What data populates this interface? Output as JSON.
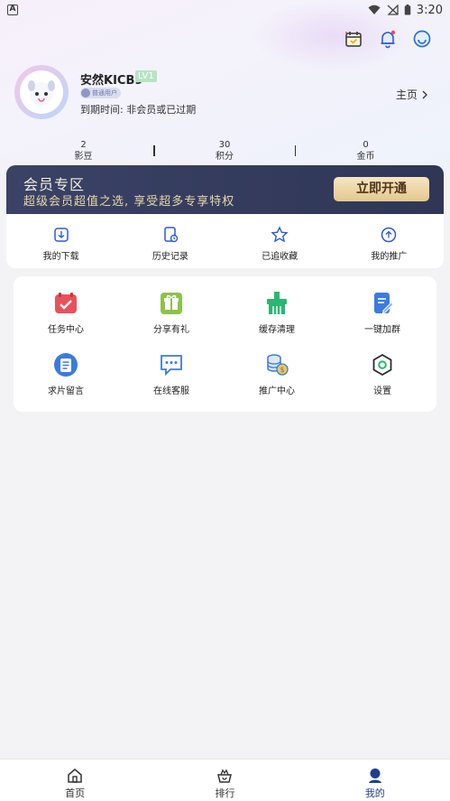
{
  "status_bar": {
    "left_indicator": "A",
    "time": "3:20"
  },
  "profile": {
    "username": "安然KICB9",
    "level": "LV1",
    "user_type": "普通用户",
    "expire_text": "到期时间: 非会员或已过期",
    "home_link": "主页"
  },
  "stats": [
    {
      "value": "2",
      "label": "影豆"
    },
    {
      "value": "30",
      "label": "积分"
    },
    {
      "value": "0",
      "label": "金币"
    }
  ],
  "vip": {
    "title": "会员专区",
    "description": "超级会员超值之选, 享受超多专享特权",
    "button": "立即开通"
  },
  "quick_actions": [
    {
      "label": "我的下载",
      "icon": "download-icon"
    },
    {
      "label": "历史记录",
      "icon": "history-icon"
    },
    {
      "label": "已追收藏",
      "icon": "star-icon"
    },
    {
      "label": "我的推广",
      "icon": "promote-icon"
    }
  ],
  "grid": [
    {
      "label": "任务中心",
      "icon": "task-center-icon",
      "color": "#e8515a"
    },
    {
      "label": "分享有礼",
      "icon": "gift-icon",
      "color": "#8bc34a"
    },
    {
      "label": "缓存清理",
      "icon": "cache-clean-icon",
      "color": "#2bb673"
    },
    {
      "label": "一键加群",
      "icon": "join-group-icon",
      "color": "#3b7be0"
    },
    {
      "label": "求片留言",
      "icon": "request-icon",
      "color": "#3b7be0"
    },
    {
      "label": "在线客服",
      "icon": "customer-service-icon",
      "color": "#3b7be0"
    },
    {
      "label": "推广中心",
      "icon": "promotion-center-icon",
      "color": "#3b7be0"
    },
    {
      "label": "设置",
      "icon": "settings-icon",
      "color": "#2a2a2a"
    }
  ],
  "bottom_nav": [
    {
      "label": "首页",
      "icon": "home-icon"
    },
    {
      "label": "排行",
      "icon": "ranking-icon"
    },
    {
      "label": "我的",
      "icon": "profile-icon",
      "active": true
    }
  ],
  "colors": {
    "accent": "#1f3f8f",
    "vip_bg": "#353d5f",
    "vip_gold": "#e4c78f"
  }
}
